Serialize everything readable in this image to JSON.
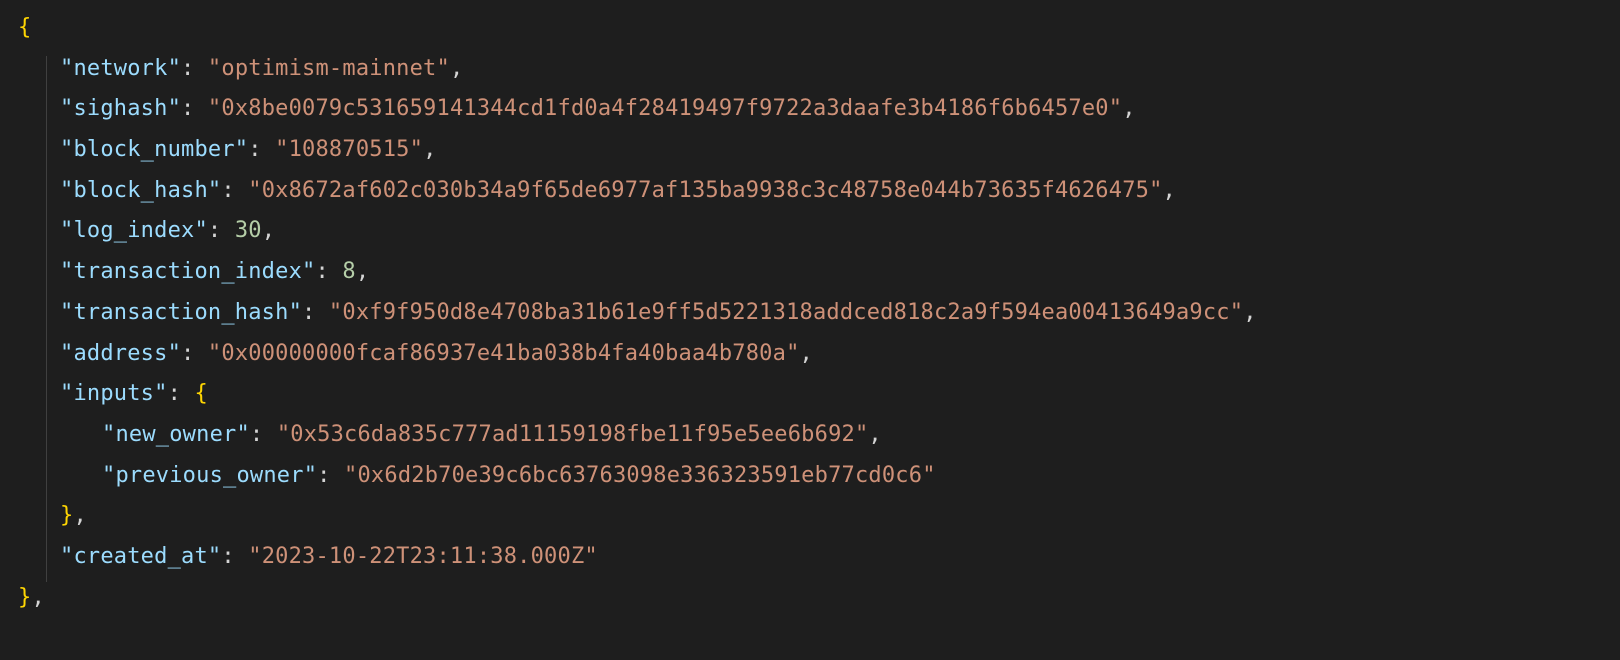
{
  "code": {
    "obj": {
      "network": "optimism-mainnet",
      "sighash": "0x8be0079c531659141344cd1fd0a4f28419497f9722a3daafe3b4186f6b6457e0",
      "block_number": "108870515",
      "block_hash": "0x8672af602c030b34a9f65de6977af135ba9938c3c48758e044b73635f4626475",
      "log_index": 30,
      "transaction_index": 8,
      "transaction_hash": "0xf9f950d8e4708ba31b61e9ff5d5221318addced818c2a9f594ea00413649a9cc",
      "address": "0x00000000fcaf86937e41ba038b4fa40baa4b780a",
      "inputs": {
        "new_owner": "0x53c6da835c777ad11159198fbe11f95e5ee6b692",
        "previous_owner": "0x6d2b70e39c6bc63763098e336323591eb77cd0c6"
      },
      "created_at": "2023-10-22T23:11:38.000Z"
    },
    "keys": {
      "network": "network",
      "sighash": "sighash",
      "block_number": "block_number",
      "block_hash": "block_hash",
      "log_index": "log_index",
      "transaction_index": "transaction_index",
      "transaction_hash": "transaction_hash",
      "address": "address",
      "inputs": "inputs",
      "new_owner": "new_owner",
      "previous_owner": "previous_owner",
      "created_at": "created_at"
    },
    "punct": {
      "open_brace": "{",
      "close_brace": "}",
      "close_brace_comma": "},",
      "quote": "\"",
      "colon_sp": ": ",
      "comma": ","
    }
  }
}
